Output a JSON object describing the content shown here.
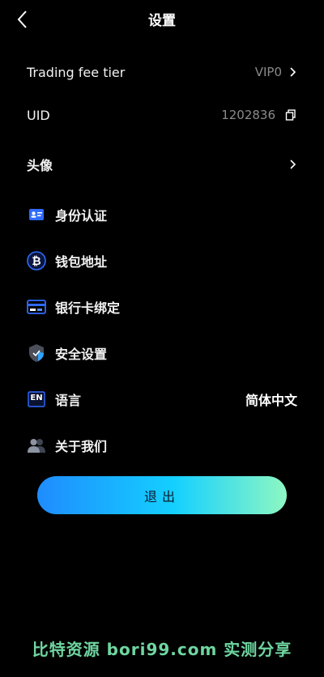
{
  "header": {
    "title": "设置",
    "back_icon": "chevron-left-icon"
  },
  "rows": {
    "fee_tier": {
      "label": "Trading fee tier",
      "value": "VIP0"
    },
    "uid": {
      "label": "UID",
      "value": "1202836",
      "icon": "copy-icon"
    },
    "avatar": {
      "label": "头像"
    },
    "identity": {
      "label": "身份认证",
      "icon": "id-card-icon"
    },
    "wallet": {
      "label": "钱包地址",
      "icon": "bitcoin-icon"
    },
    "bank": {
      "label": "银行卡绑定",
      "icon": "bank-card-icon"
    },
    "security": {
      "label": "安全设置",
      "icon": "shield-icon"
    },
    "language": {
      "label": "语言",
      "value": "简体中文",
      "icon": "language-en-icon",
      "icon_text": "EN"
    },
    "about": {
      "label": "关于我们",
      "icon": "users-icon"
    }
  },
  "logout": {
    "label": "退出"
  },
  "watermark": {
    "text": "比特资源 bori99.com 实测分享"
  },
  "colors": {
    "background": "#000000",
    "accent_blue": "#2f6bff",
    "gradient_start": "#1f8cff",
    "gradient_end": "#8ef7c2",
    "muted_text": "#8a8a8a",
    "watermark": "#6fd5a0"
  }
}
